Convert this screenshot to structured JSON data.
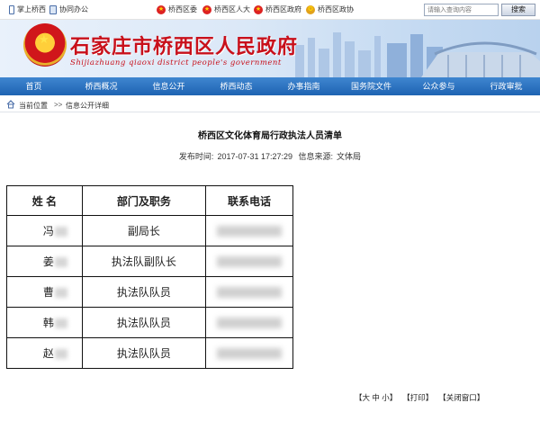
{
  "topbar": {
    "links": [
      {
        "label": "掌上桥西",
        "icon": "phone-icon"
      },
      {
        "label": "协同办公",
        "icon": "tablet-icon"
      }
    ],
    "orgs": [
      {
        "label": "桥西区委",
        "icon": "party-emblem-icon"
      },
      {
        "label": "桥西区人大",
        "icon": "national-emblem-icon"
      },
      {
        "label": "桥西区政府",
        "icon": "national-emblem-icon"
      },
      {
        "label": "桥西区政协",
        "icon": "cppcc-emblem-icon"
      }
    ],
    "search_placeholder": "请输入查询内容",
    "search_button": "搜索"
  },
  "banner": {
    "title": "石家庄市桥西区人民政府",
    "subtitle": "Shijiazhuang qiaoxi district people's government"
  },
  "nav": [
    "首页",
    "桥西概况",
    "信息公开",
    "桥西动态",
    "办事指南",
    "国务院文件",
    "公众参与",
    "行政审批"
  ],
  "breadcrumb": {
    "current_label": "当前位置",
    "separator": ">>",
    "page": "信息公开详细"
  },
  "article": {
    "title": "桥西区文化体育局行政执法人员清单",
    "publish_label": "发布时间:",
    "publish_time": "2017-07-31 17:27:29",
    "source_label": "信息来源:",
    "source": "文体局"
  },
  "roster": {
    "headers": [
      "姓 名",
      "部门及职务",
      "联系电话"
    ],
    "rows": [
      {
        "surname": "冯",
        "position": "副局长"
      },
      {
        "surname": "姜",
        "position": "执法队副队长"
      },
      {
        "surname": "曹",
        "position": "执法队队员"
      },
      {
        "surname": "韩",
        "position": "执法队队员"
      },
      {
        "surname": "赵",
        "position": "执法队队员"
      }
    ]
  },
  "footer": {
    "font_size": "【大 中 小】",
    "print": "【打印】",
    "close": "【关闭窗口】"
  },
  "colors": {
    "nav_blue": "#2f78c6",
    "title_red": "#c8101b"
  }
}
